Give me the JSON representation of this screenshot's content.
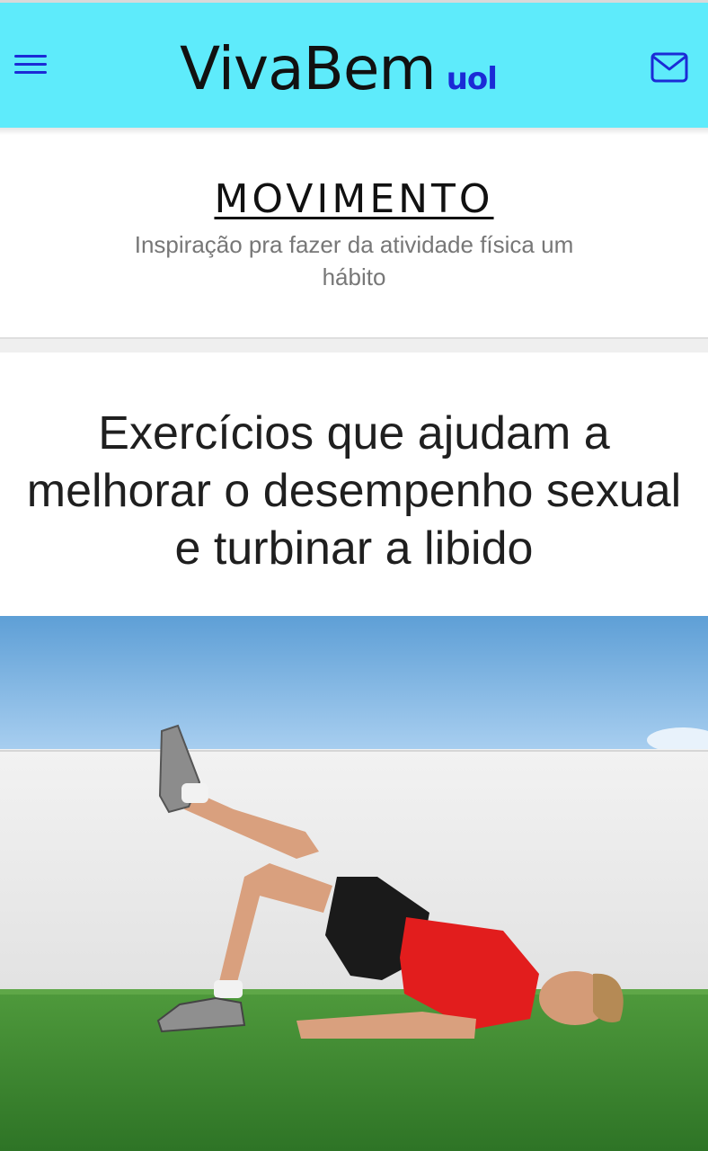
{
  "header": {
    "logo_main": "VivaBem",
    "logo_sub": "uol",
    "menu_icon": "hamburger-menu-icon",
    "mail_icon": "mail-icon",
    "background_color": "#5eebfb",
    "accent_color": "#1b2bd6"
  },
  "section": {
    "title": "MOVIMENTO",
    "subtitle": "Inspiração pra fazer da atividade física um hábito"
  },
  "article": {
    "headline": "Exercícios que ajudam a melhorar o desempenho sexual e turbinar a libido"
  }
}
